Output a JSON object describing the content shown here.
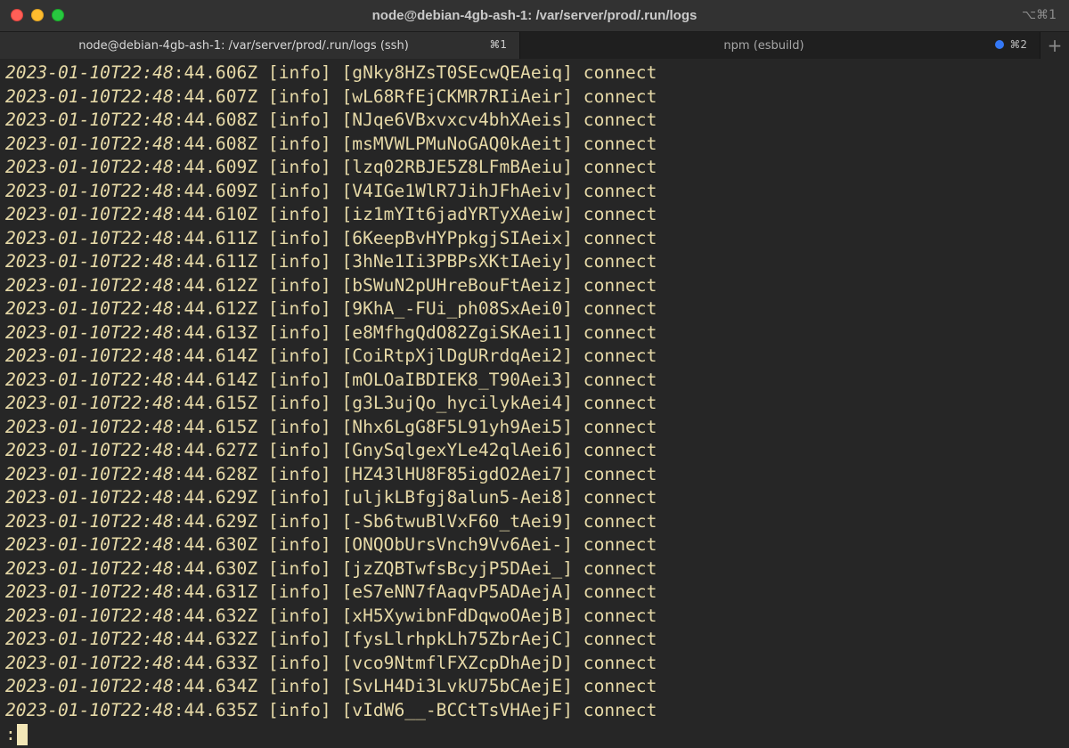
{
  "window": {
    "title": "node@debian-4gb-ash-1: /var/server/prod/.run/logs",
    "shortcut_hint": "⌥⌘1"
  },
  "tabs": [
    {
      "label": "node@debian-4gb-ash-1: /var/server/prod/.run/logs (ssh)",
      "shortcut": "⌘1",
      "active": true
    },
    {
      "label": "npm (esbuild)",
      "shortcut": "⌘2",
      "active": false,
      "activity": true
    }
  ],
  "new_tab_label": "+",
  "terminal": {
    "lines": [
      {
        "date": "2023-01-10T22:48",
        "rest": ":44.606Z [info] [gNky8HZsT0SEcwQEAeiq] connect"
      },
      {
        "date": "2023-01-10T22:48",
        "rest": ":44.607Z [info] [wL68RfEjCKMR7RIiAeir] connect"
      },
      {
        "date": "2023-01-10T22:48",
        "rest": ":44.608Z [info] [NJqe6VBxvxcv4bhXAeis] connect"
      },
      {
        "date": "2023-01-10T22:48",
        "rest": ":44.608Z [info] [msMVWLPMuNoGAQ0kAeit] connect"
      },
      {
        "date": "2023-01-10T22:48",
        "rest": ":44.609Z [info] [lzq02RBJE5Z8LFmBAeiu] connect"
      },
      {
        "date": "2023-01-10T22:48",
        "rest": ":44.609Z [info] [V4IGe1WlR7JihJFhAeiv] connect"
      },
      {
        "date": "2023-01-10T22:48",
        "rest": ":44.610Z [info] [iz1mYIt6jadYRTyXAeiw] connect"
      },
      {
        "date": "2023-01-10T22:48",
        "rest": ":44.611Z [info] [6KeepBvHYPpkgjSIAeix] connect"
      },
      {
        "date": "2023-01-10T22:48",
        "rest": ":44.611Z [info] [3hNe1Ii3PBPsXKtIAeiy] connect"
      },
      {
        "date": "2023-01-10T22:48",
        "rest": ":44.612Z [info] [bSWuN2pUHreBouFtAeiz] connect"
      },
      {
        "date": "2023-01-10T22:48",
        "rest": ":44.612Z [info] [9KhA_-FUi_ph08SxAei0] connect"
      },
      {
        "date": "2023-01-10T22:48",
        "rest": ":44.613Z [info] [e8MfhgQdO82ZgiSKAei1] connect"
      },
      {
        "date": "2023-01-10T22:48",
        "rest": ":44.614Z [info] [CoiRtpXjlDgURrdqAei2] connect"
      },
      {
        "date": "2023-01-10T22:48",
        "rest": ":44.614Z [info] [mOLOaIBDIEK8_T90Aei3] connect"
      },
      {
        "date": "2023-01-10T22:48",
        "rest": ":44.615Z [info] [g3L3ujQo_hycilykAei4] connect"
      },
      {
        "date": "2023-01-10T22:48",
        "rest": ":44.615Z [info] [Nhx6LgG8F5L91yh9Aei5] connect"
      },
      {
        "date": "2023-01-10T22:48",
        "rest": ":44.627Z [info] [GnySqlgexYLe42qlAei6] connect"
      },
      {
        "date": "2023-01-10T22:48",
        "rest": ":44.628Z [info] [HZ43lHU8F85igdO2Aei7] connect"
      },
      {
        "date": "2023-01-10T22:48",
        "rest": ":44.629Z [info] [uljkLBfgj8alun5-Aei8] connect"
      },
      {
        "date": "2023-01-10T22:48",
        "rest": ":44.629Z [info] [-Sb6twuBlVxF60_tAei9] connect"
      },
      {
        "date": "2023-01-10T22:48",
        "rest": ":44.630Z [info] [ONQObUrsVnch9Vv6Aei-] connect"
      },
      {
        "date": "2023-01-10T22:48",
        "rest": ":44.630Z [info] [jzZQBTwfsBcyjP5DAei_] connect"
      },
      {
        "date": "2023-01-10T22:48",
        "rest": ":44.631Z [info] [eS7eNN7fAaqvP5ADAejA] connect"
      },
      {
        "date": "2023-01-10T22:48",
        "rest": ":44.632Z [info] [xH5XywibnFdDqwoOAejB] connect"
      },
      {
        "date": "2023-01-10T22:48",
        "rest": ":44.632Z [info] [fysLlrhpkLh75ZbrAejC] connect"
      },
      {
        "date": "2023-01-10T22:48",
        "rest": ":44.633Z [info] [vco9NtmflFXZcpDhAejD] connect"
      },
      {
        "date": "2023-01-10T22:48",
        "rest": ":44.634Z [info] [SvLH4Di3LvkU75bCAejE] connect"
      },
      {
        "date": "2023-01-10T22:48",
        "rest": ":44.635Z [info] [vIdW6__-BCCtTsVHAejF] connect"
      }
    ],
    "prompt": ":"
  },
  "colors": {
    "terminal_text": "#e6d9a7",
    "terminal_bg": "#262626",
    "activity_dot": "#3478f6"
  }
}
